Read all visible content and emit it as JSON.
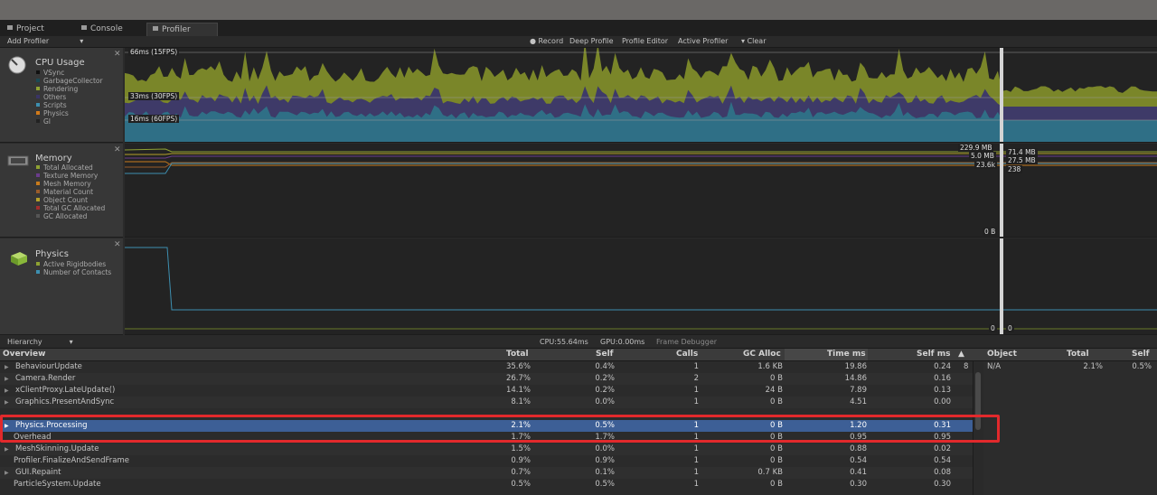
{
  "tabs": [
    {
      "label": "Project"
    },
    {
      "label": "Console"
    },
    {
      "label": "Profiler"
    }
  ],
  "toolbar": {
    "add_profiler": "Add Profiler",
    "record": "Record",
    "deep_profile": "Deep Profile",
    "profile_editor": "Profile Editor",
    "active_profiler": "Active Profiler",
    "clear": "Clear"
  },
  "cpu": {
    "title": "CPU Usage",
    "legend": [
      {
        "label": "VSync",
        "color": "#111111"
      },
      {
        "label": "GarbageCollector",
        "color": "#1b4a55"
      },
      {
        "label": "Rendering",
        "color": "#8fa232"
      },
      {
        "label": "Others",
        "color": "#3a3466"
      },
      {
        "label": "Scripts",
        "color": "#3d8fb0"
      },
      {
        "label": "Physics",
        "color": "#d17a1a"
      },
      {
        "label": "GI",
        "color": "#222222"
      }
    ],
    "marker_66": "66ms (15FPS)",
    "marker_33": "33ms (30FPS)",
    "marker_16": "16ms (60FPS)"
  },
  "memory": {
    "title": "Memory",
    "legend": [
      {
        "label": "Total Allocated",
        "color": "#8fa232"
      },
      {
        "label": "Texture Memory",
        "color": "#6a3c8c"
      },
      {
        "label": "Mesh Memory",
        "color": "#c87b1c"
      },
      {
        "label": "Material Count",
        "color": "#9a5c2a"
      },
      {
        "label": "Object Count",
        "color": "#b5a02a"
      },
      {
        "label": "Total GC Allocated",
        "color": "#a02d2d"
      },
      {
        "label": "GC Allocated",
        "color": "#555555"
      }
    ],
    "values_left": [
      "229.9 MB",
      "5.0 MB",
      "23.6k",
      "0 B"
    ],
    "values_right": [
      "71.4 MB",
      "27.5 MB",
      "238"
    ]
  },
  "physics": {
    "title": "Physics",
    "legend": [
      {
        "label": "Active Rigidbodies",
        "color": "#8fa232"
      },
      {
        "label": "Number of Contacts",
        "color": "#3d8fb0"
      }
    ],
    "value_left": "0",
    "value_right": "0"
  },
  "hierarchy": {
    "mode": "Hierarchy",
    "cpu_label": "CPU:55.64ms",
    "gpu_label": "GPU:0.00ms",
    "frame_debugger": "Frame Debugger",
    "columns": {
      "overview": "Overview",
      "total": "Total",
      "self": "Self",
      "calls": "Calls",
      "gc_alloc": "GC Alloc",
      "time_ms": "Time ms",
      "self_ms": "Self ms",
      "sort_icon": "▲"
    },
    "rows": [
      {
        "name": "BehaviourUpdate",
        "total": "35.6%",
        "self": "0.4%",
        "calls": "1",
        "gc": "1.6 KB",
        "time": "19.86",
        "selfms": "0.24",
        "arrow": true,
        "extra": "8"
      },
      {
        "name": "Camera.Render",
        "total": "26.7%",
        "self": "0.2%",
        "calls": "2",
        "gc": "0 B",
        "time": "14.86",
        "selfms": "0.16",
        "arrow": true
      },
      {
        "name": "xClientProxy.LateUpdate()",
        "total": "14.1%",
        "self": "0.2%",
        "calls": "1",
        "gc": "24 B",
        "time": "7.89",
        "selfms": "0.13",
        "arrow": true
      },
      {
        "name": "Graphics.PresentAndSync",
        "total": "8.1%",
        "self": "0.0%",
        "calls": "1",
        "gc": "0 B",
        "time": "4.51",
        "selfms": "0.00",
        "arrow": true
      },
      {
        "name": "",
        "total": "",
        "self": "",
        "calls": "",
        "gc": "",
        "time": "",
        "selfms": "",
        "arrow": false
      },
      {
        "name": "Physics.Processing",
        "total": "2.1%",
        "self": "0.5%",
        "calls": "1",
        "gc": "0 B",
        "time": "1.20",
        "selfms": "0.31",
        "arrow": true,
        "selected": true
      },
      {
        "name": "Overhead",
        "total": "1.7%",
        "self": "1.7%",
        "calls": "1",
        "gc": "0 B",
        "time": "0.95",
        "selfms": "0.95",
        "arrow": false
      },
      {
        "name": "MeshSkinning.Update",
        "total": "1.5%",
        "self": "0.0%",
        "calls": "1",
        "gc": "0 B",
        "time": "0.88",
        "selfms": "0.02",
        "arrow": true
      },
      {
        "name": "Profiler.FinalizeAndSendFrame",
        "total": "0.9%",
        "self": "0.9%",
        "calls": "1",
        "gc": "0 B",
        "time": "0.54",
        "selfms": "0.54",
        "arrow": false
      },
      {
        "name": "GUI.Repaint",
        "total": "0.7%",
        "self": "0.1%",
        "calls": "1",
        "gc": "0.7 KB",
        "time": "0.41",
        "selfms": "0.08",
        "arrow": true
      },
      {
        "name": "ParticleSystem.Update",
        "total": "0.5%",
        "self": "0.5%",
        "calls": "1",
        "gc": "0 B",
        "time": "0.30",
        "selfms": "0.30",
        "arrow": false
      }
    ]
  },
  "object_panel": {
    "col_object": "Object",
    "col_total": "Total",
    "col_self": "Self",
    "row_object": "N/A",
    "row_total": "2.1%",
    "row_self": "0.5%"
  }
}
